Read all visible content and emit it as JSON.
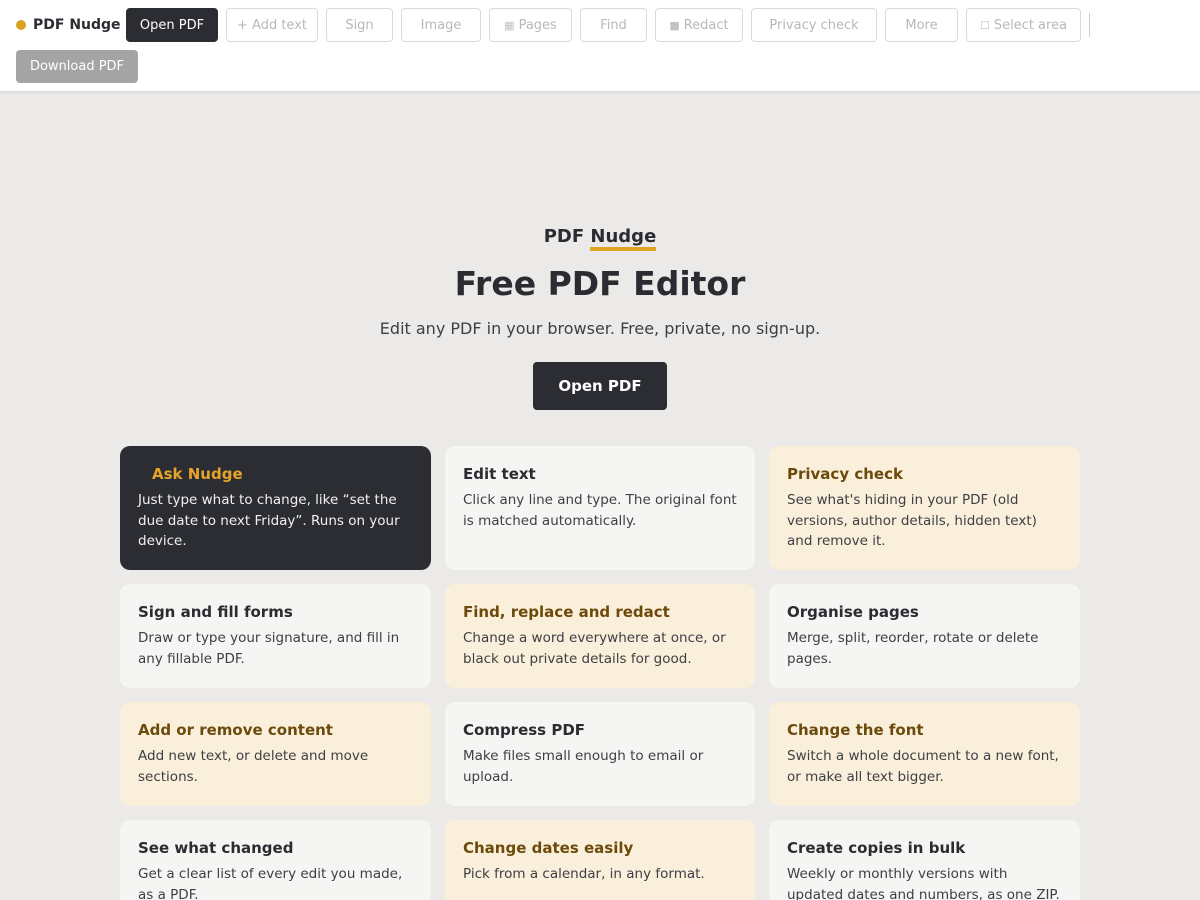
{
  "app": {
    "name": "PDF Nudge",
    "accent_color": "#d9a021",
    "dark_color": "#2b2d33"
  },
  "toolbar": {
    "open_label": "Open PDF",
    "add_text_label": "+ Add text",
    "sign_label": "Sign",
    "image_label": "Image",
    "pages_icon": "grid-icon",
    "pages_label": "Pages",
    "find_label": "Find",
    "redact_icon": "square-filled-icon",
    "redact_label": "Redact",
    "privacy_label": "Privacy check",
    "more_label": "More",
    "select_icon": "square-outline-icon",
    "select_label": "Select area",
    "download_label": "Download PDF"
  },
  "hero": {
    "brand_prefix": "PDF",
    "brand_accent": "Nudge",
    "title": "Free PDF Editor",
    "subtitle": "Edit any PDF in your browser. Free, private, no sign-up.",
    "cta_label": "Open PDF"
  },
  "features": [
    {
      "title": "Ask Nudge",
      "desc": "Just type what to change, like “set the due date to next Friday”. Runs on your device.",
      "style": "dark"
    },
    {
      "title": "Edit text",
      "desc": "Click any line and type. The original font is matched automatically.",
      "style": "plain"
    },
    {
      "title": "Privacy check",
      "desc": "See what's hiding in your PDF (old versions, author details, hidden text) and remove it.",
      "style": "warm"
    },
    {
      "title": "Sign and fill forms",
      "desc": "Draw or type your signature, and fill in any fillable PDF.",
      "style": "plain"
    },
    {
      "title": "Find, replace and redact",
      "desc": "Change a word everywhere at once, or black out private details for good.",
      "style": "warm"
    },
    {
      "title": "Organise pages",
      "desc": "Merge, split, reorder, rotate or delete pages.",
      "style": "plain"
    },
    {
      "title": "Add or remove content",
      "desc": "Add new text, or delete and move sections.",
      "style": "warm"
    },
    {
      "title": "Compress PDF",
      "desc": "Make files small enough to email or upload.",
      "style": "plain"
    },
    {
      "title": "Change the font",
      "desc": "Switch a whole document to a new font, or make all text bigger.",
      "style": "warm"
    },
    {
      "title": "See what changed",
      "desc": "Get a clear list of every edit you made, as a PDF.",
      "style": "plain"
    },
    {
      "title": "Change dates easily",
      "desc": "Pick from a calendar, in any format.",
      "style": "warm"
    },
    {
      "title": "Create copies in bulk",
      "desc": "Weekly or monthly versions with updated dates and numbers, as one ZIP.",
      "style": "plain"
    }
  ]
}
